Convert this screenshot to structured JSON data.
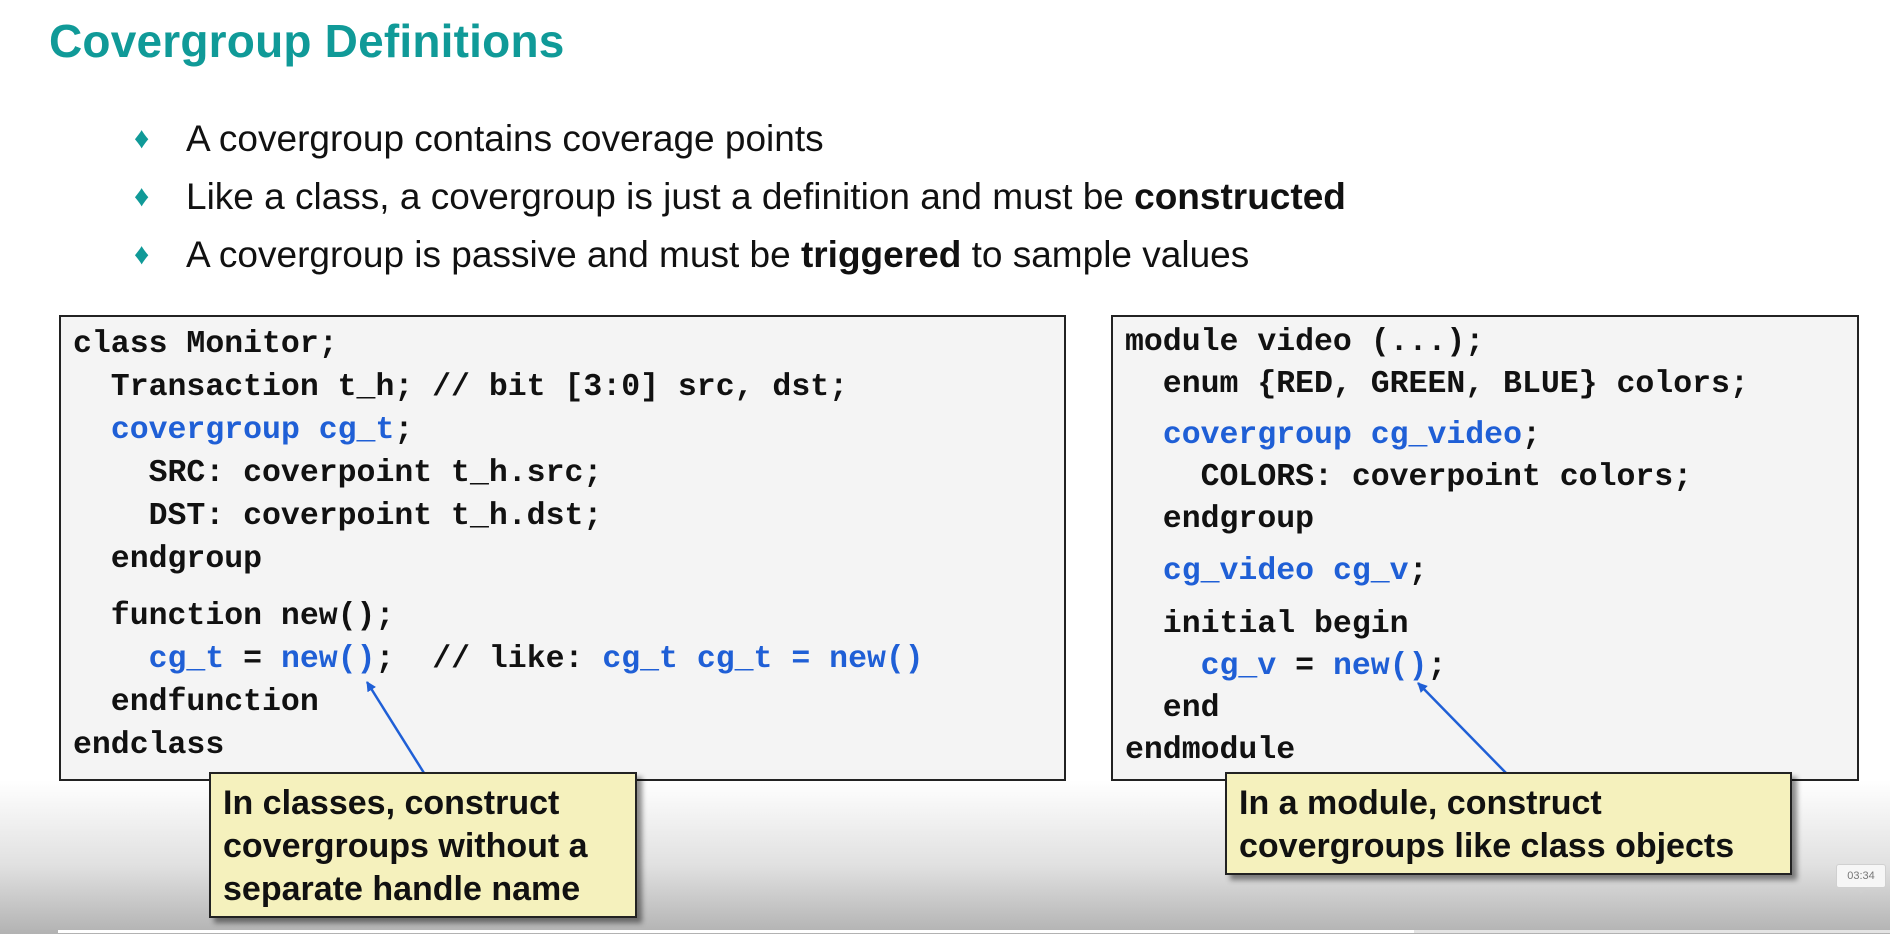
{
  "slide": {
    "title": "Covergroup Definitions",
    "bullets": [
      {
        "parts": [
          "A covergroup contains coverage points"
        ]
      },
      {
        "parts": [
          "Like a class, a covergroup is just a definition and must be ",
          "constructed"
        ]
      },
      {
        "parts": [
          "A covergroup is passive and must be ",
          "triggered",
          " to sample values"
        ]
      }
    ],
    "bullet_symbol": "♦",
    "left_code": [
      [
        {
          "t": "class Monitor;"
        }
      ],
      [
        {
          "t": "  Transaction t_h; // bit [3:0] src, dst;"
        }
      ],
      [
        {
          "t": "  "
        },
        {
          "t": "covergroup cg_t",
          "k": 1
        },
        {
          "t": ";"
        }
      ],
      [
        {
          "t": "    SRC: coverpoint t_h.src;"
        }
      ],
      [
        {
          "t": "    DST: coverpoint t_h.dst;"
        }
      ],
      [
        {
          "t": "  endgroup"
        }
      ],
      [
        {
          "t": "  function new();"
        }
      ],
      [
        {
          "t": "    "
        },
        {
          "t": "cg_t",
          "k": 1
        },
        {
          "t": " = "
        },
        {
          "t": "new()",
          "k": 1
        },
        {
          "t": ";  // like: "
        },
        {
          "t": "cg_t cg_t = new()",
          "k": 1
        }
      ],
      [
        {
          "t": "  endfunction"
        }
      ],
      [
        {
          "t": "endclass"
        }
      ]
    ],
    "right_code": [
      [
        {
          "t": "module video (...);"
        }
      ],
      [
        {
          "t": "  enum {RED, GREEN, BLUE} colors;"
        }
      ],
      [
        {
          "t": "  "
        },
        {
          "t": "covergroup cg_video",
          "k": 1
        },
        {
          "t": ";"
        }
      ],
      [
        {
          "t": "    COLORS: coverpoint colors;"
        }
      ],
      [
        {
          "t": "  endgroup"
        }
      ],
      [
        {
          "t": "  "
        },
        {
          "t": "cg_video cg_v",
          "k": 1
        },
        {
          "t": ";"
        }
      ],
      [
        {
          "t": "  initial begin"
        }
      ],
      [
        {
          "t": "    "
        },
        {
          "t": "cg_v",
          "k": 1
        },
        {
          "t": " = "
        },
        {
          "t": "new()",
          "k": 1
        },
        {
          "t": ";"
        }
      ],
      [
        {
          "t": "  end"
        }
      ],
      [
        {
          "t": "endmodule"
        }
      ]
    ],
    "left_callout": [
      "In classes, construct",
      "covergroups without a",
      "separate handle name"
    ],
    "right_callout": [
      "In a module, construct",
      "covergroups like class objects"
    ]
  },
  "player": {
    "timestamp": "03:34",
    "progress": 0.74
  },
  "colors": {
    "title": "#109a98",
    "keyword": "#1f5fd6",
    "callout_bg": "#f5f1bd",
    "arrow": "#1f5fd6"
  }
}
